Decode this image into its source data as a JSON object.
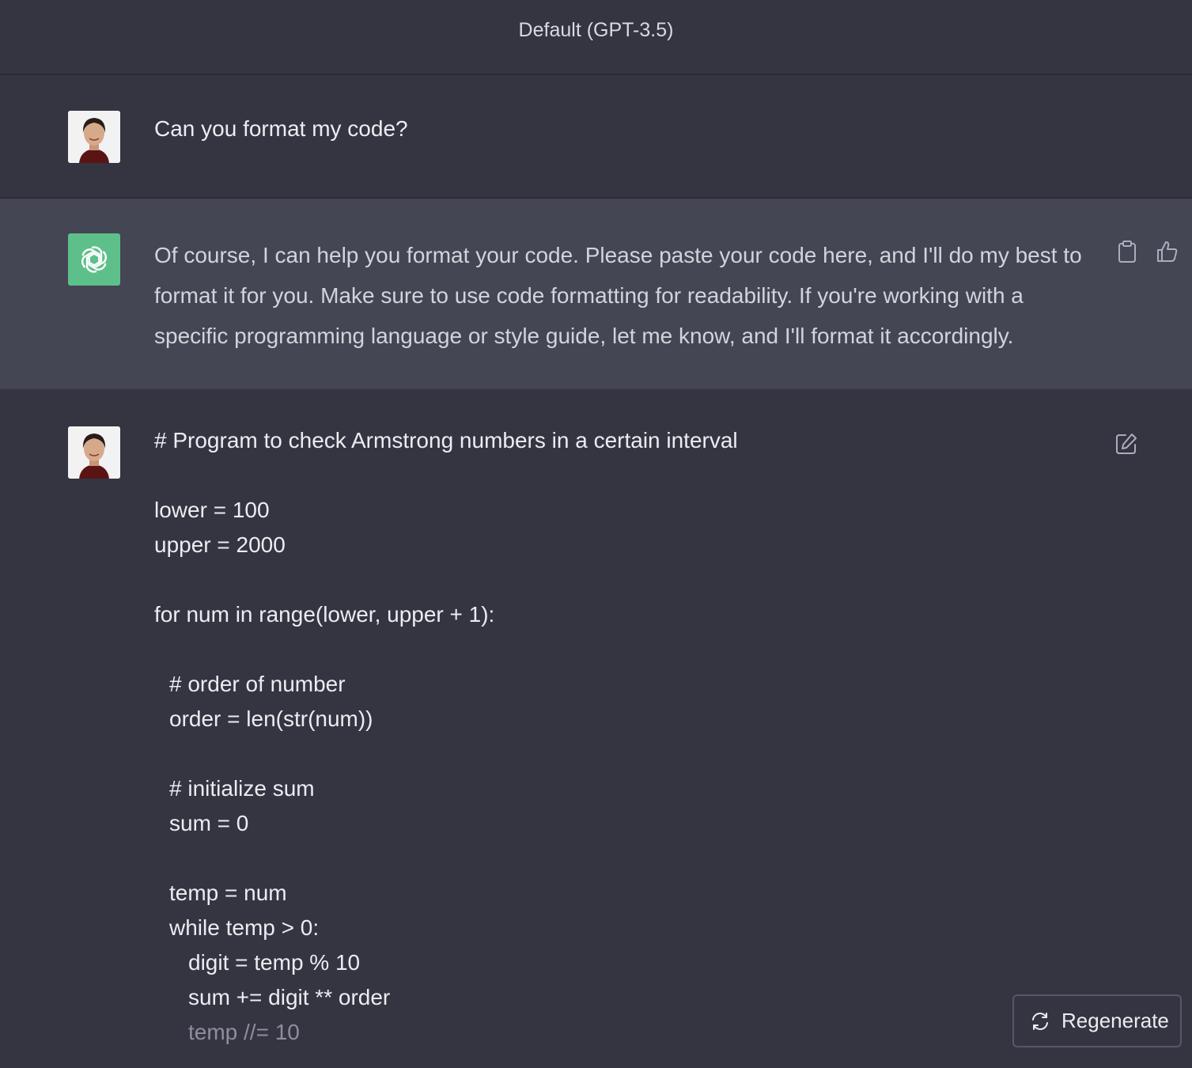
{
  "header": {
    "title": "Default (GPT-3.5)"
  },
  "messages": {
    "user_first": {
      "text": "Can you format my code?"
    },
    "assistant": {
      "text": "Of course, I can help you format your code. Please paste your code here, and I'll do my best to format it for you. Make sure to use code formatting for readability. If you're working with a specific programming language or style guide, let me know, and I'll format it accordingly."
    },
    "user_second": {
      "lines": [
        "# Program to check Armstrong numbers in a certain interval",
        "lower = 100",
        "upper = 2000",
        "for num in range(lower, upper + 1):",
        "# order of number",
        "order = len(str(num))",
        "# initialize sum",
        "sum = 0",
        "temp = num",
        "while temp > 0:",
        "digit = temp % 10",
        "sum += digit ** order",
        "temp //= 10"
      ]
    }
  },
  "actions": {
    "regenerate_label": "Regenerate"
  },
  "icons": {
    "assistant_logo": "openai-logo-icon",
    "copy": "clipboard-icon",
    "like": "thumbs-up-icon",
    "edit": "edit-icon",
    "regenerate": "refresh-icon"
  },
  "colors": {
    "background": "#343541",
    "assistant_background": "#444654",
    "assistant_avatar": "#5dc08a",
    "text": "#ececf1"
  }
}
